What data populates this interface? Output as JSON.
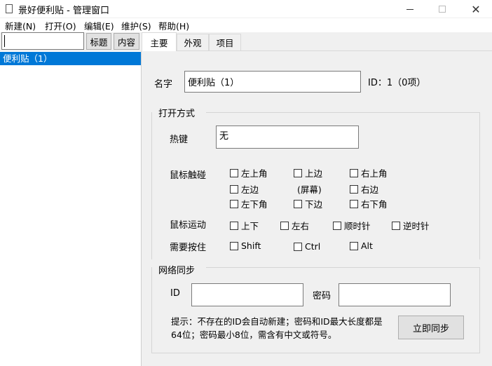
{
  "window": {
    "title": "景好便利贴 - 管理窗口"
  },
  "menu": [
    "新建(N)",
    "打开(O)",
    "编辑(E)",
    "维护(S)",
    "帮助(H)"
  ],
  "search": {
    "value": ""
  },
  "filter_buttons": [
    "标题",
    "内容"
  ],
  "tabs": [
    "主要",
    "外观",
    "项目"
  ],
  "list": {
    "items": [
      "便利贴（1）"
    ]
  },
  "main": {
    "name_label": "名字",
    "name_value": "便利贴（1）",
    "id_text": "ID：1（0项）",
    "open_group_title": "打开方式",
    "hotkey_label": "热键",
    "hotkey_value": "无",
    "mouse_touch_label": "鼠标触碰",
    "touch_options": {
      "top_left": "左上角",
      "top": "上边",
      "top_right": "右上角",
      "left": "左边",
      "center": "(屏幕)",
      "right": "右边",
      "bottom_left": "左下角",
      "bottom": "下边",
      "bottom_right": "右下角"
    },
    "mouse_move_label": "鼠标运动",
    "move_options": [
      "上下",
      "左右",
      "顺时针",
      "逆时针"
    ],
    "hold_label": "需要按住",
    "hold_options": [
      "Shift",
      "Ctrl",
      "Alt"
    ],
    "sync_group_title": "网络同步",
    "id_label": "ID",
    "id_input": "",
    "password_label": "密码",
    "password_input": "",
    "hint_text": "提示：不存在的ID会自动新建；密码和ID最大长度都是64位；密码最小8位，需含有中文或符号。",
    "sync_button": "立即同步"
  }
}
